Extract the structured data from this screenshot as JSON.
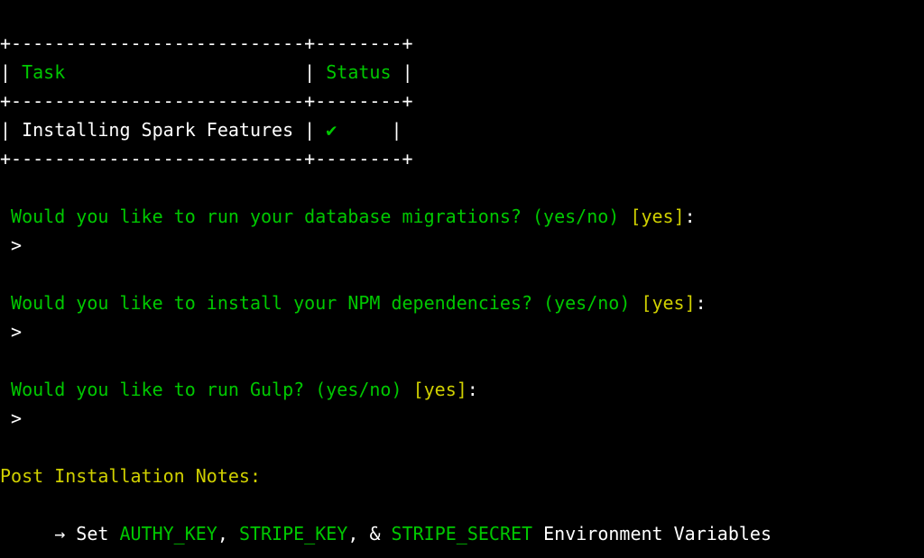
{
  "table": {
    "border_top": "+---------------------------+--------+",
    "header_pipe": "|",
    "col1_header": "Task",
    "col1_pad": "                      ",
    "col2_header": "Status",
    "col2_pad": " ",
    "border_mid": "+---------------------------+--------+",
    "row1_col1": "Installing Spark Features",
    "row1_pad1": " ",
    "row1_check": "✔",
    "row1_pad2": "     ",
    "border_bot": "+---------------------------+--------+"
  },
  "prompts": {
    "p1_question": " Would you like to run your database migrations? (yes/no) ",
    "p1_bracket_open": "[",
    "p1_default": "yes",
    "p1_bracket_close": "]",
    "p1_colon": ":",
    "p1_caret": " > ",
    "p2_question": " Would you like to install your NPM dependencies? (yes/no) ",
    "p2_bracket_open": "[",
    "p2_default": "yes",
    "p2_bracket_close": "]",
    "p2_colon": ":",
    "p2_caret": " > ",
    "p3_question": " Would you like to run Gulp? (yes/no) ",
    "p3_bracket_open": "[",
    "p3_default": "yes",
    "p3_bracket_close": "]",
    "p3_colon": ":",
    "p3_caret": " > "
  },
  "notes": {
    "title": "Post Installation Notes:",
    "arrow": "     → ",
    "set_prefix": "Set ",
    "var1": "AUTHY_KEY",
    "comma1": ", ",
    "var2": "STRIPE_KEY",
    "comma2": ", ",
    "amp": "& ",
    "var3": "STRIPE_SECRET",
    "suffix": " Environment Variables"
  }
}
